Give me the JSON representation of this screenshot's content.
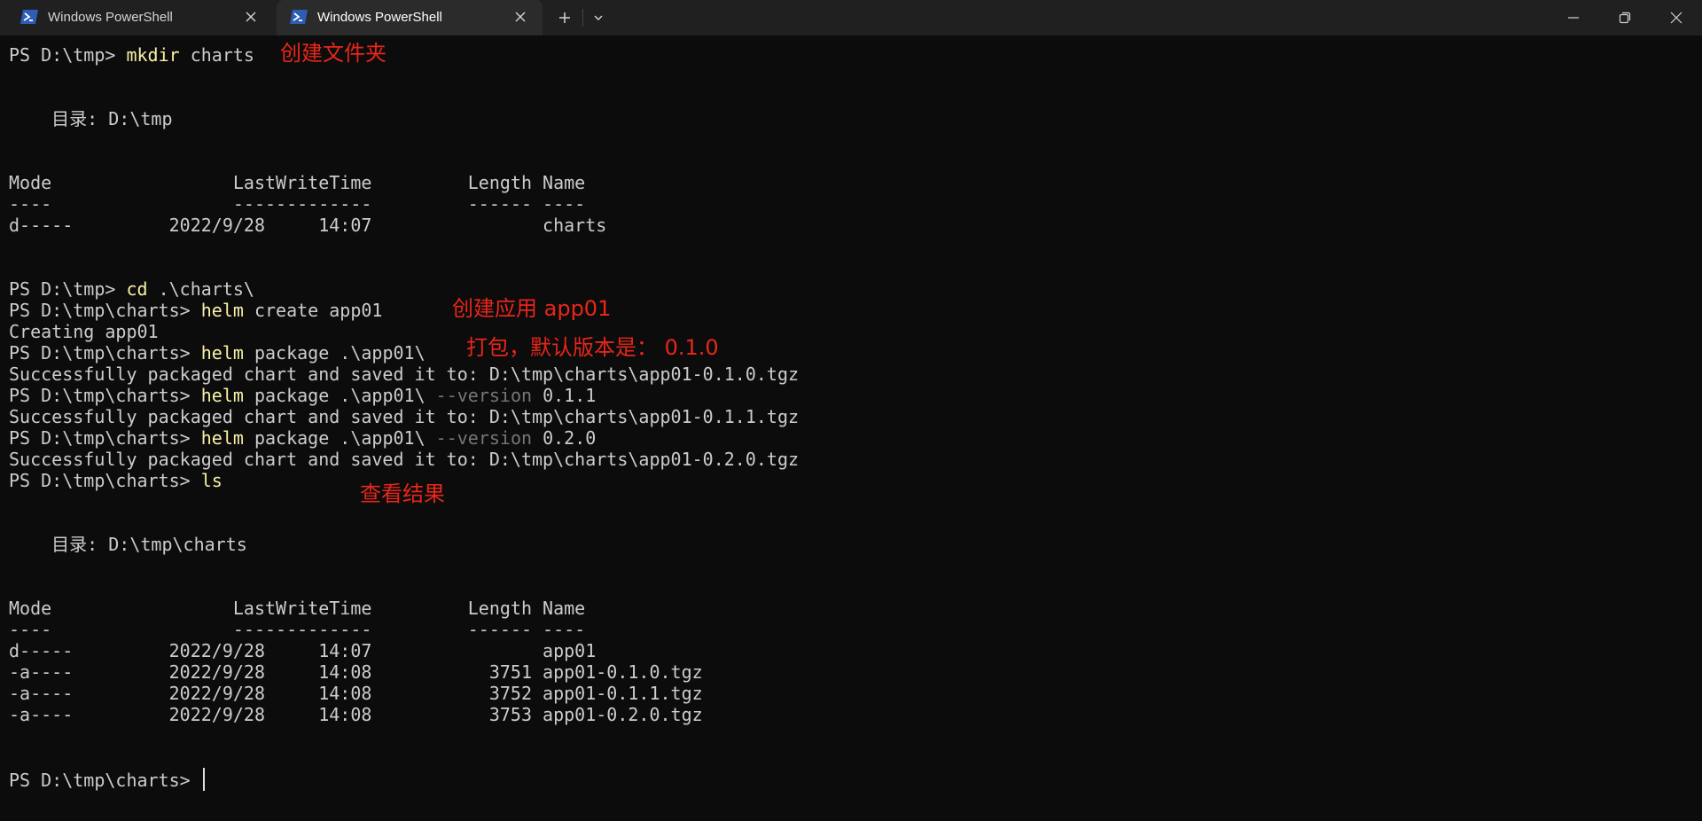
{
  "window": {
    "tabs": [
      {
        "label": "Windows PowerShell",
        "active": false
      },
      {
        "label": "Windows PowerShell",
        "active": true
      }
    ],
    "icons": [
      "powershell-icon",
      "close-icon",
      "plus-icon",
      "chevron-down-icon",
      "minimize-icon",
      "maximize-icon",
      "window-close-icon"
    ]
  },
  "terminal": {
    "prompt_tmp": "PS D:\\tmp> ",
    "prompt_charts": "PS D:\\tmp\\charts> ",
    "cmd_mkdir": "mkdir",
    "arg_mkdir": " charts",
    "dir_line_1": "    目录: D:\\tmp",
    "table_header": "Mode                 LastWriteTime         Length Name",
    "table_rule": "----                 -------------         ------ ----",
    "row_charts": "d-----         2022/9/28     14:07                charts",
    "cmd_cd": "cd",
    "arg_cd": " .\\charts\\",
    "cmd_helm": "helm",
    "arg_create": " create app01",
    "out_creating": "Creating app01",
    "arg_package": " package .\\app01\\",
    "out_pkg_010": "Successfully packaged chart and saved it to: D:\\tmp\\charts\\app01-0.1.0.tgz",
    "arg_package_v": " package .\\app01\\ ",
    "flag_version": "--version",
    "ver_011": " 0.1.1",
    "out_pkg_011": "Successfully packaged chart and saved it to: D:\\tmp\\charts\\app01-0.1.1.tgz",
    "ver_020": " 0.2.0",
    "out_pkg_020": "Successfully packaged chart and saved it to: D:\\tmp\\charts\\app01-0.2.0.tgz",
    "cmd_ls": "ls",
    "dir_line_2": "    目录: D:\\tmp\\charts",
    "rows_charts_dir": [
      "d-----         2022/9/28     14:07                app01",
      "-a----         2022/9/28     14:08           3751 app01-0.1.0.tgz",
      "-a----         2022/9/28     14:08           3752 app01-0.1.1.tgz",
      "-a----         2022/9/28     14:08           3753 app01-0.2.0.tgz"
    ]
  },
  "annotations": {
    "create_folder": "创建文件夹",
    "create_app": "创建应用 app01",
    "package_default": "打包，默认版本是： 0.1.0",
    "view_result": "查看结果",
    "color": "#e8261b"
  },
  "colors": {
    "background": "#0c0c0c",
    "text": "#cccccc",
    "command": "#f9f1a5",
    "parameter": "#767676",
    "titlebar": "#202020",
    "active_tab": "#2b2b2b"
  }
}
